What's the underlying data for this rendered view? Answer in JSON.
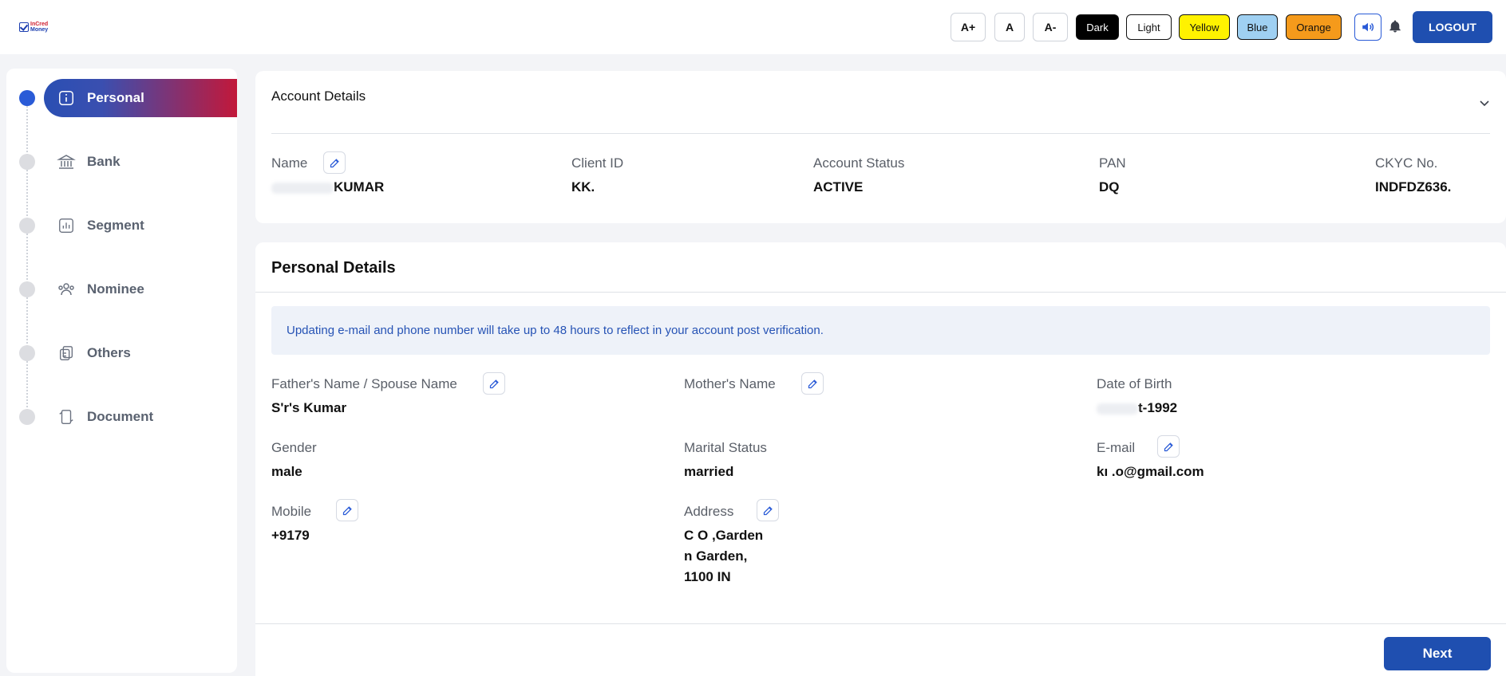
{
  "header": {
    "logo": {
      "line1": "InCred",
      "line2": "Money"
    },
    "font_buttons": [
      "A+",
      "A",
      "A-"
    ],
    "themes": [
      {
        "label": "Dark",
        "bg": "#000000",
        "color": "#ffffff"
      },
      {
        "label": "Light",
        "bg": "#ffffff",
        "color": "#111111"
      },
      {
        "label": "Yellow",
        "bg": "#fff200",
        "color": "#111111"
      },
      {
        "label": "Blue",
        "bg": "#9fd0f2",
        "color": "#111111"
      },
      {
        "label": "Orange",
        "bg": "#f59a1b",
        "color": "#111111"
      }
    ],
    "logout_label": "LOGOUT"
  },
  "sidebar": {
    "items": [
      {
        "label": "Personal",
        "icon": "info-icon",
        "active": true
      },
      {
        "label": "Bank",
        "icon": "bank-icon",
        "active": false
      },
      {
        "label": "Segment",
        "icon": "chart-icon",
        "active": false
      },
      {
        "label": "Nominee",
        "icon": "users-icon",
        "active": false
      },
      {
        "label": "Others",
        "icon": "documents-icon",
        "active": false
      },
      {
        "label": "Document",
        "icon": "phone-icon",
        "active": false
      }
    ]
  },
  "account": {
    "title": "Account Details",
    "fields": [
      {
        "label": "Name",
        "value": "KUMAR"
      },
      {
        "label": "Client ID",
        "value": "KK."
      },
      {
        "label": "Account Status",
        "value": "ACTIVE"
      },
      {
        "label": "PAN",
        "value": "DQ"
      },
      {
        "label": "CKYC No.",
        "value": "INDFDZ636."
      }
    ]
  },
  "personal": {
    "title": "Personal Details",
    "notice": "Updating e-mail and phone number will take up to 48 hours to reflect in your account post verification.",
    "fields": [
      {
        "label": "Father's Name / Spouse Name",
        "value": "S'r's Kumar"
      },
      {
        "label": "Mother's Name",
        "value": ""
      },
      {
        "label": "Date of Birth",
        "value": "t-1992"
      },
      {
        "label": "Gender",
        "value": "male"
      },
      {
        "label": "Marital Status",
        "value": "married"
      },
      {
        "label": "E-mail",
        "value": "kı .o@gmail.com"
      },
      {
        "label": "Mobile",
        "value": "+9179"
      },
      {
        "label": "Address",
        "lines": [
          "C O ,Garden",
          "n Garden,",
          "1100 IN"
        ]
      }
    ],
    "next_label": "Next"
  },
  "colors": {
    "primary": "#1f4fb0",
    "accent_red": "#c2183a",
    "notice_bg": "#eef2f9"
  }
}
